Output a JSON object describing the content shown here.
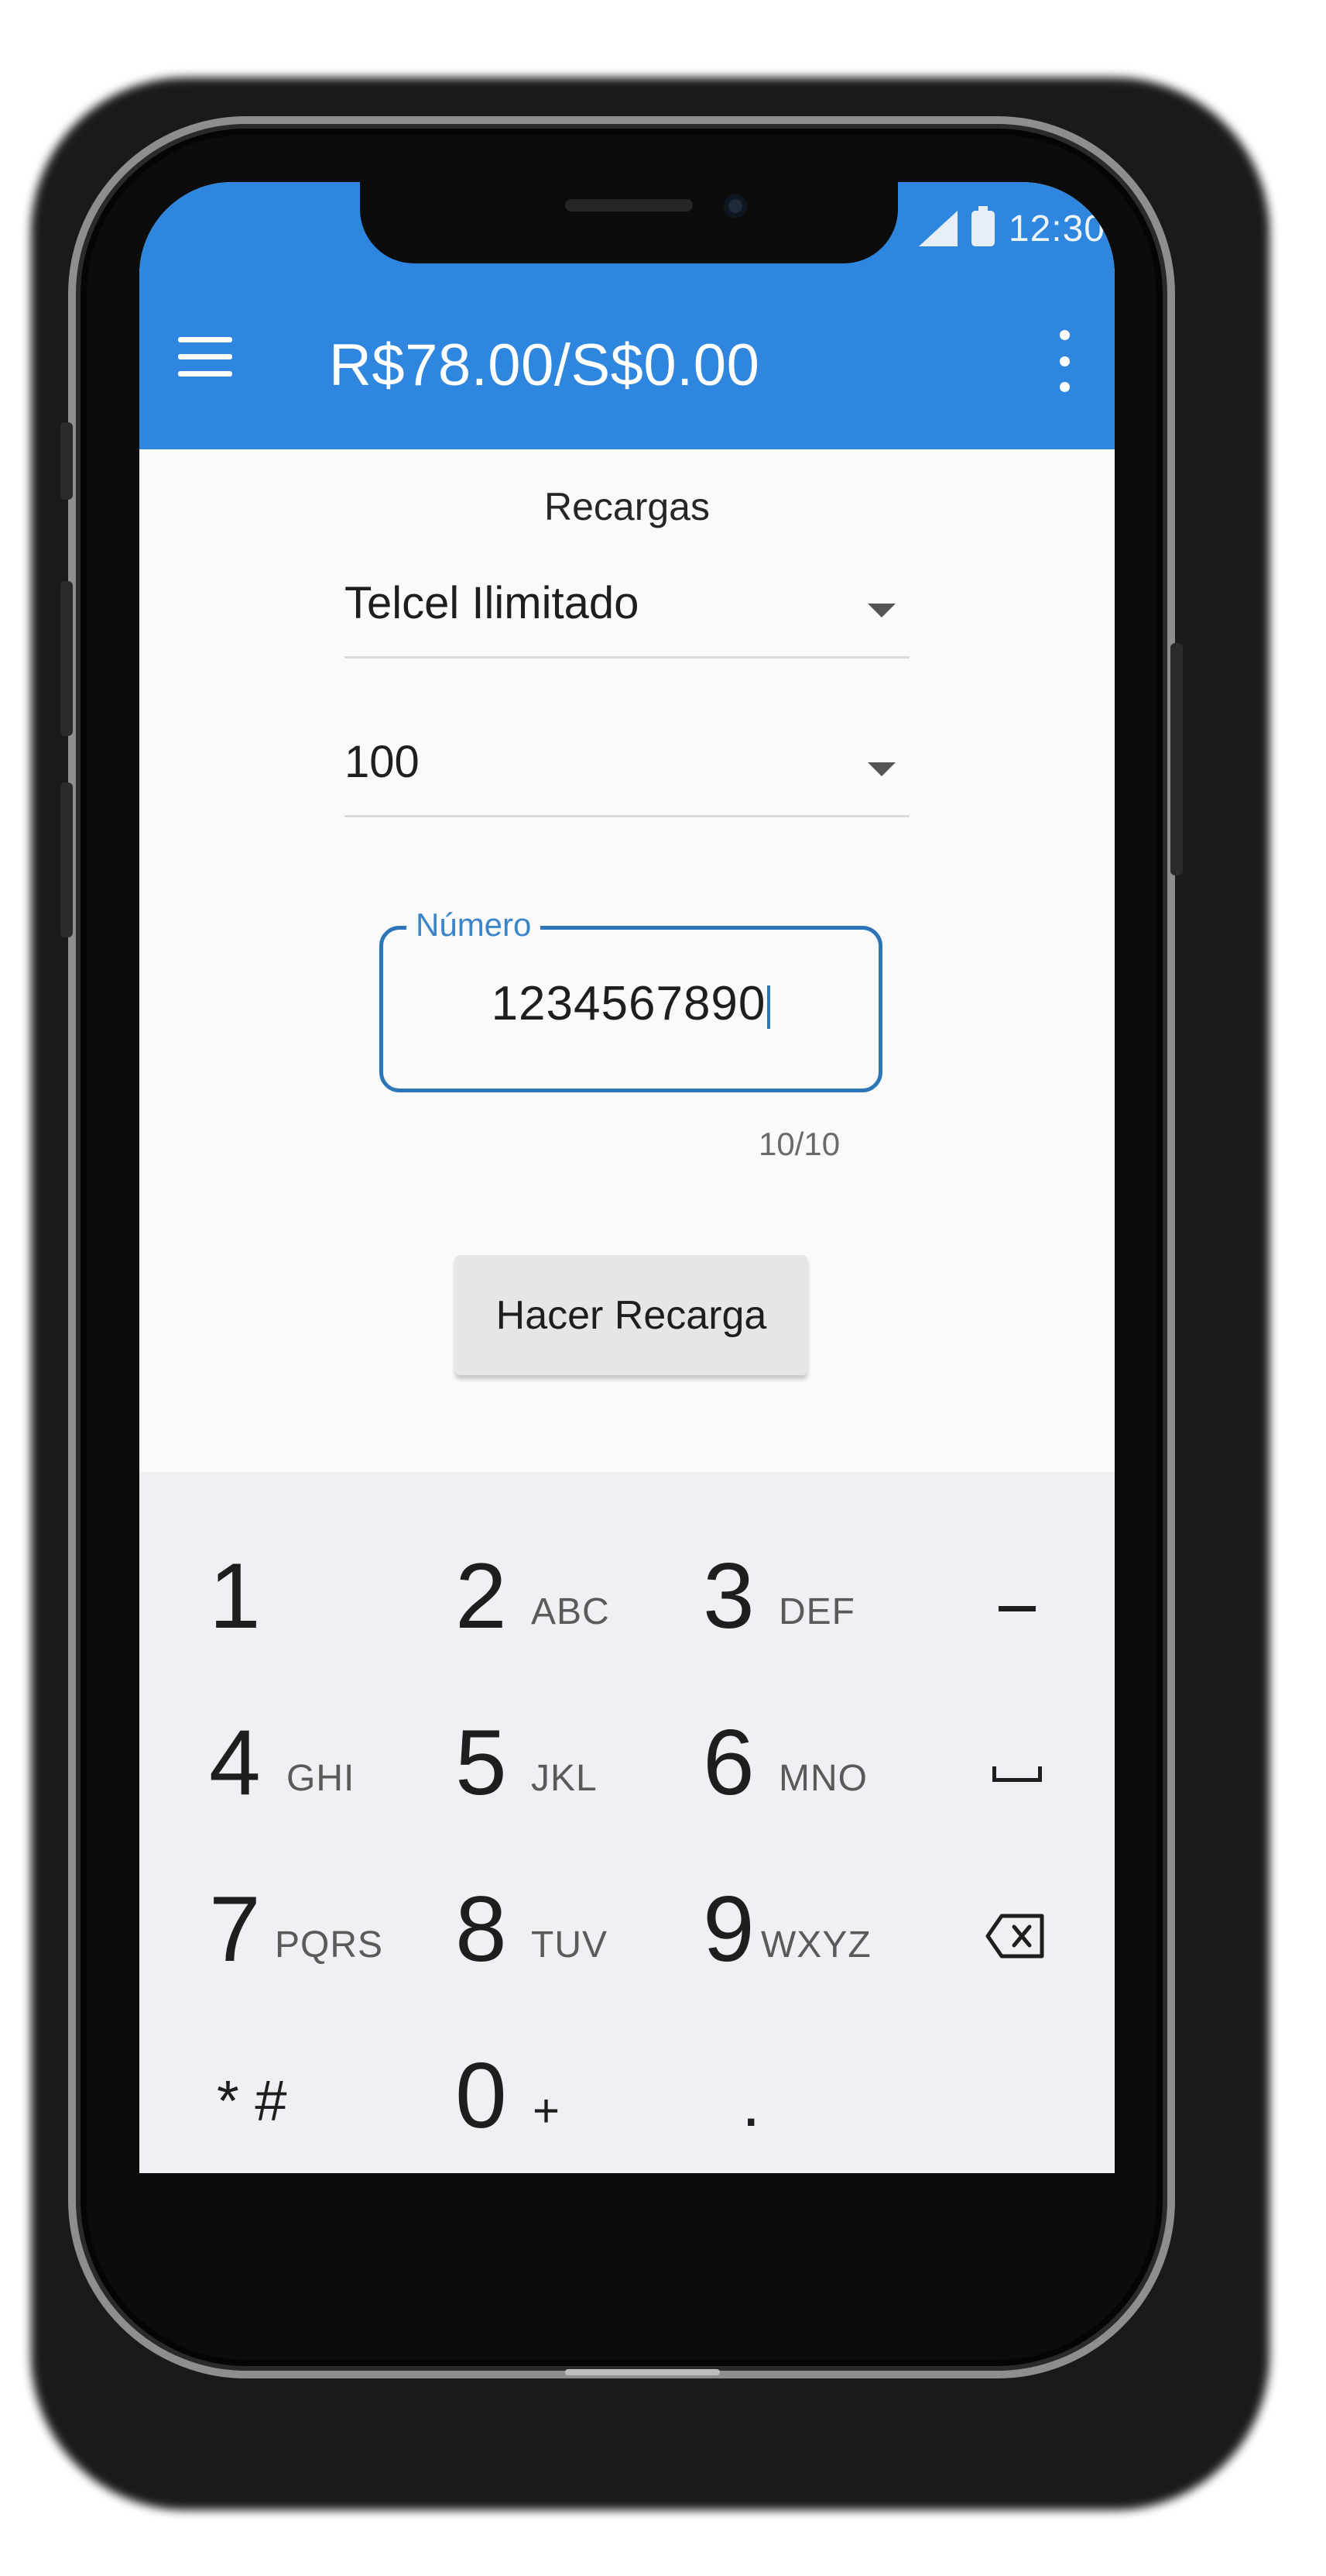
{
  "status_bar": {
    "time": "12:30"
  },
  "app_bar": {
    "title": "R$78.00/S$0.00"
  },
  "form": {
    "section_title": "Recargas",
    "operator": "Telcel Ilimitado",
    "amount": "100",
    "number_label": "Número",
    "number_value": "1234567890",
    "counter": "10/10",
    "submit_label": "Hacer Recarga"
  },
  "keypad": {
    "keys": [
      {
        "digit": "1",
        "letters": ""
      },
      {
        "digit": "2",
        "letters": "ABC"
      },
      {
        "digit": "3",
        "letters": "DEF"
      },
      {
        "digit": "4",
        "letters": "GHI"
      },
      {
        "digit": "5",
        "letters": "JKL"
      },
      {
        "digit": "6",
        "letters": "MNO"
      },
      {
        "digit": "7",
        "letters": "PQRS"
      },
      {
        "digit": "8",
        "letters": "TUV"
      },
      {
        "digit": "9",
        "letters": "WXYZ"
      },
      {
        "digit": "0",
        "letters": "+"
      }
    ],
    "star_hash": "* #",
    "dot": ".",
    "confirm_color": "#3fb8a6"
  },
  "theme": {
    "app_bar_color": "#2e86de",
    "accent": "#2c76b8"
  }
}
